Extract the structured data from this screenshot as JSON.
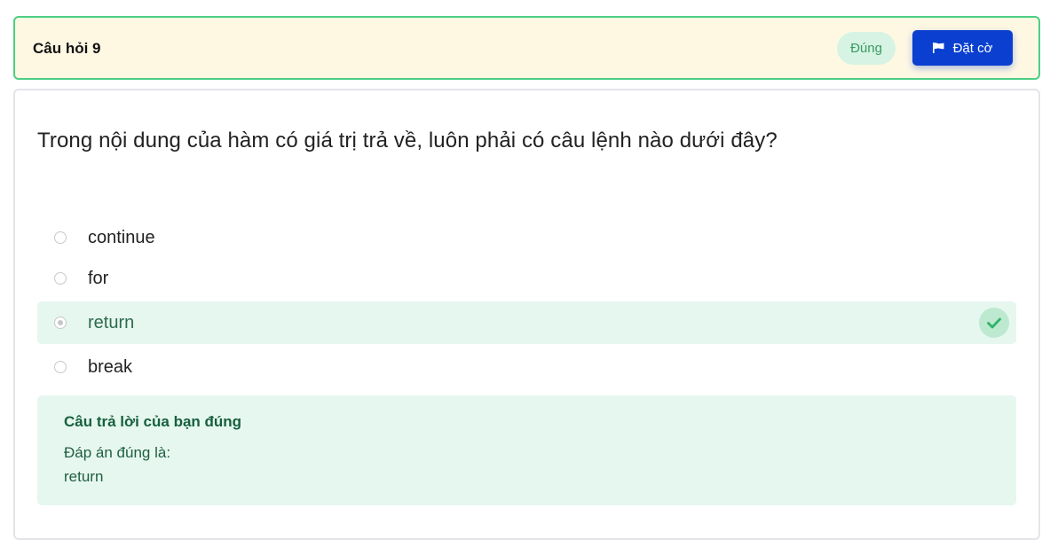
{
  "header": {
    "title": "Câu hỏi 9",
    "status": "Đúng",
    "flag_label": "Đặt cờ",
    "flag_icon": "flag-icon"
  },
  "question": {
    "text": "Trong nội dung của hàm có giá trị trả về, luôn phải có câu lệnh nào dưới đây?"
  },
  "options": [
    {
      "label": "continue",
      "selected": false
    },
    {
      "label": "for",
      "selected": false
    },
    {
      "label": "return",
      "selected": true,
      "correct_icon": "check-icon"
    },
    {
      "label": "break",
      "selected": false
    }
  ],
  "feedback": {
    "title": "Câu trả lời của bạn đúng",
    "answer_prefix": "Đáp án đúng là:",
    "answer": "return"
  },
  "colors": {
    "header_bg": "#fef8e3",
    "header_border": "#4ccf85",
    "accent_blue": "#0a3fd0",
    "success_bg": "#e6f7ef",
    "success_text": "#17603e"
  }
}
